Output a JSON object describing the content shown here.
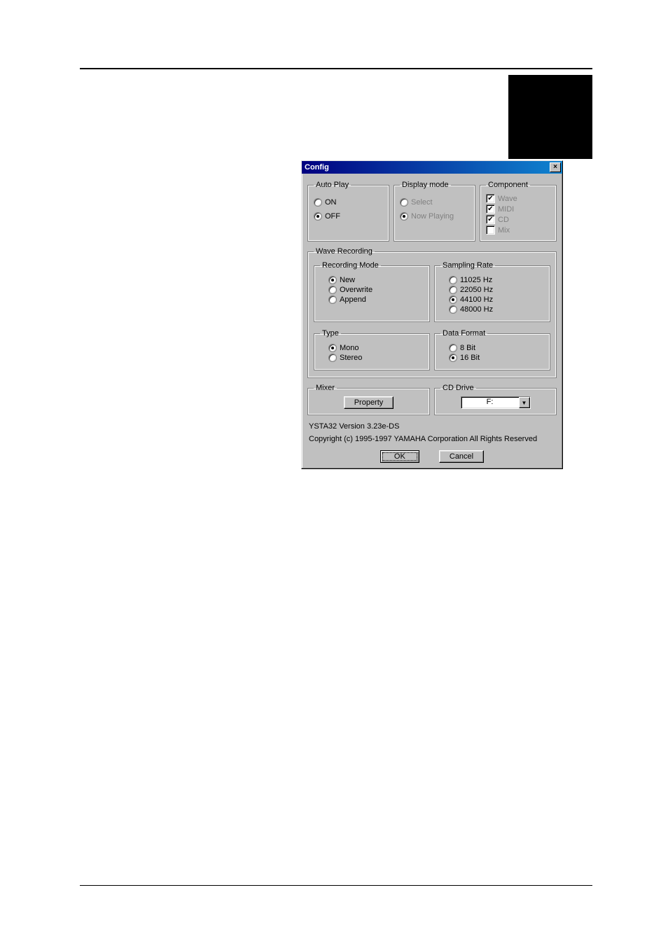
{
  "dialog": {
    "title": "Config",
    "autoPlay": {
      "legend": "Auto Play",
      "on": "ON",
      "off": "OFF",
      "selected": "OFF"
    },
    "displayMode": {
      "legend": "Display mode",
      "select": "Select",
      "nowPlaying": "Now Playing",
      "selected": "Now Playing",
      "disabled": true
    },
    "component": {
      "legend": "Component",
      "items": [
        {
          "label": "Wave",
          "checked": true,
          "disabled": true
        },
        {
          "label": "MIDI",
          "checked": true,
          "disabled": true
        },
        {
          "label": "CD",
          "checked": true,
          "disabled": true
        },
        {
          "label": "Mix",
          "checked": false,
          "disabled": true
        }
      ]
    },
    "waveRecording": {
      "legend": "Wave Recording",
      "recordingMode": {
        "legend": "Recording Mode",
        "options": [
          "New",
          "Overwrite",
          "Append"
        ],
        "selected": "New"
      },
      "samplingRate": {
        "legend": "Sampling Rate",
        "options": [
          "11025 Hz",
          "22050 Hz",
          "44100 Hz",
          "48000 Hz"
        ],
        "selected": "44100 Hz"
      },
      "type": {
        "legend": "Type",
        "options": [
          "Mono",
          "Stereo"
        ],
        "selected": "Mono"
      },
      "dataFormat": {
        "legend": "Data Format",
        "options": [
          "8 Bit",
          "16 Bit"
        ],
        "selected": "16 Bit"
      }
    },
    "mixer": {
      "legend": "Mixer",
      "propertyButton": "Property"
    },
    "cdDrive": {
      "legend": "CD Drive",
      "value": "F:"
    },
    "version": "YSTA32 Version 3.23e-DS",
    "copyright": "Copyright (c) 1995-1997 YAMAHA Corporation    All Rights Reserved",
    "ok": "OK",
    "cancel": "Cancel"
  }
}
